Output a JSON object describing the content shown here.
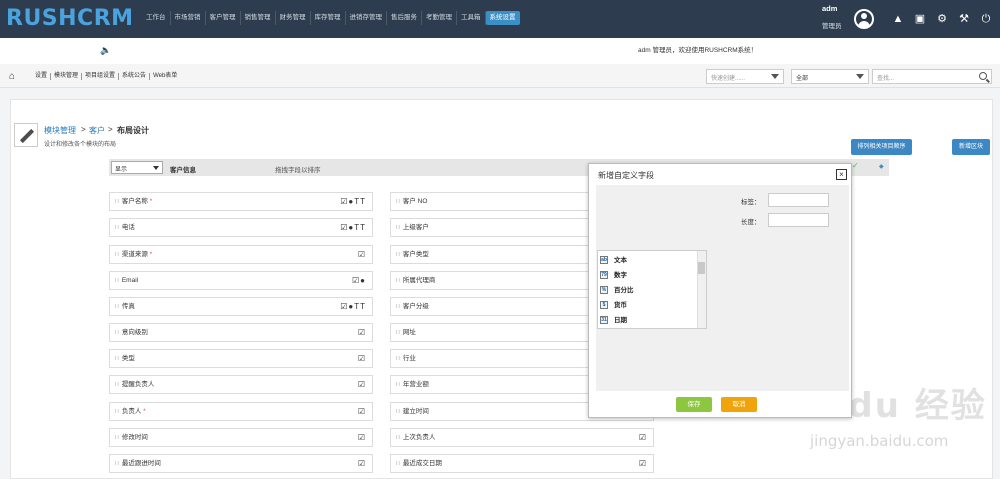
{
  "header": {
    "logo": "RUSHCRM",
    "nav": [
      "工作台",
      "市场营销",
      "客户管理",
      "销售管理",
      "财务管理",
      "库存管理",
      "进销存管理",
      "售后服务",
      "考勤管理",
      "工具箱",
      "系统设置"
    ],
    "user_name": "adm",
    "user_role": "管理员"
  },
  "notice": {
    "welcome": "adm 管理员，欢迎使用RUSHCRM系统！"
  },
  "subbar": {
    "breadcrumbs": [
      "设置",
      "模块管理",
      "项目组设置",
      "系统公告",
      "Web表单"
    ],
    "quick_create_placeholder": "快速创建......",
    "scope_value": "全部",
    "search_placeholder": "查找..."
  },
  "page": {
    "crumb_module": "模块管理",
    "crumb_client": "客户",
    "crumb_current": "布局设计",
    "sep": ">",
    "description": "设计和修改各个模块的布局",
    "btn_sort": "排列相关项目顺序",
    "btn_add_block": "新增区块"
  },
  "block": {
    "show_value": "显示",
    "title": "客户信息",
    "hint": "拖拽字段以排序"
  },
  "fields_left": [
    {
      "label": "客户名称",
      "required": "*",
      "icons": "☑●TT"
    },
    {
      "label": "电话",
      "required": "",
      "icons": "☑●TT"
    },
    {
      "label": "渠道来源",
      "required": "*",
      "icons": "☑"
    },
    {
      "label": "Email",
      "required": "",
      "icons": "☑●"
    },
    {
      "label": "传真",
      "required": "",
      "icons": "☑●TT"
    },
    {
      "label": "意向级别",
      "required": "",
      "icons": "☑"
    },
    {
      "label": "类型",
      "required": "",
      "icons": "☑"
    },
    {
      "label": "提醒负责人",
      "required": "",
      "icons": "☑"
    },
    {
      "label": "负责人",
      "required": "*",
      "icons": "☑"
    },
    {
      "label": "修改时间",
      "required": "",
      "icons": "☑"
    },
    {
      "label": "最近跟进时间",
      "required": "",
      "icons": "☑"
    }
  ],
  "fields_right": [
    {
      "label": "客户 NO",
      "icons": ""
    },
    {
      "label": "上级客户",
      "icons": ""
    },
    {
      "label": "客户类型",
      "icons": ""
    },
    {
      "label": "所属代理商",
      "icons": ""
    },
    {
      "label": "客户分级",
      "icons": ""
    },
    {
      "label": "网址",
      "icons": ""
    },
    {
      "label": "行业",
      "icons": ""
    },
    {
      "label": "年营业额",
      "icons": ""
    },
    {
      "label": "建立时间",
      "icons": ""
    },
    {
      "label": "上次负责人",
      "icons": "☑"
    },
    {
      "label": "最近成交日期",
      "icons": "☑"
    }
  ],
  "modal": {
    "title": "新增自定义字段",
    "label_label": "标签：",
    "length_label": "长度：",
    "types": [
      {
        "icon": "ab",
        "label": "文本"
      },
      {
        "icon": "79",
        "label": "数字"
      },
      {
        "icon": "%",
        "label": "百分比"
      },
      {
        "icon": "$",
        "label": "货币"
      },
      {
        "icon": "31",
        "label": "日期"
      }
    ],
    "save": "保存",
    "cancel": "取消"
  },
  "watermark": {
    "main": "Bai du 经验",
    "sub": "jingyan.baidu.com"
  },
  "colors": {
    "topbar": "#2d3c4e",
    "accent": "#3c88c4",
    "save": "#8dc63f",
    "cancel": "#f0a30a"
  }
}
